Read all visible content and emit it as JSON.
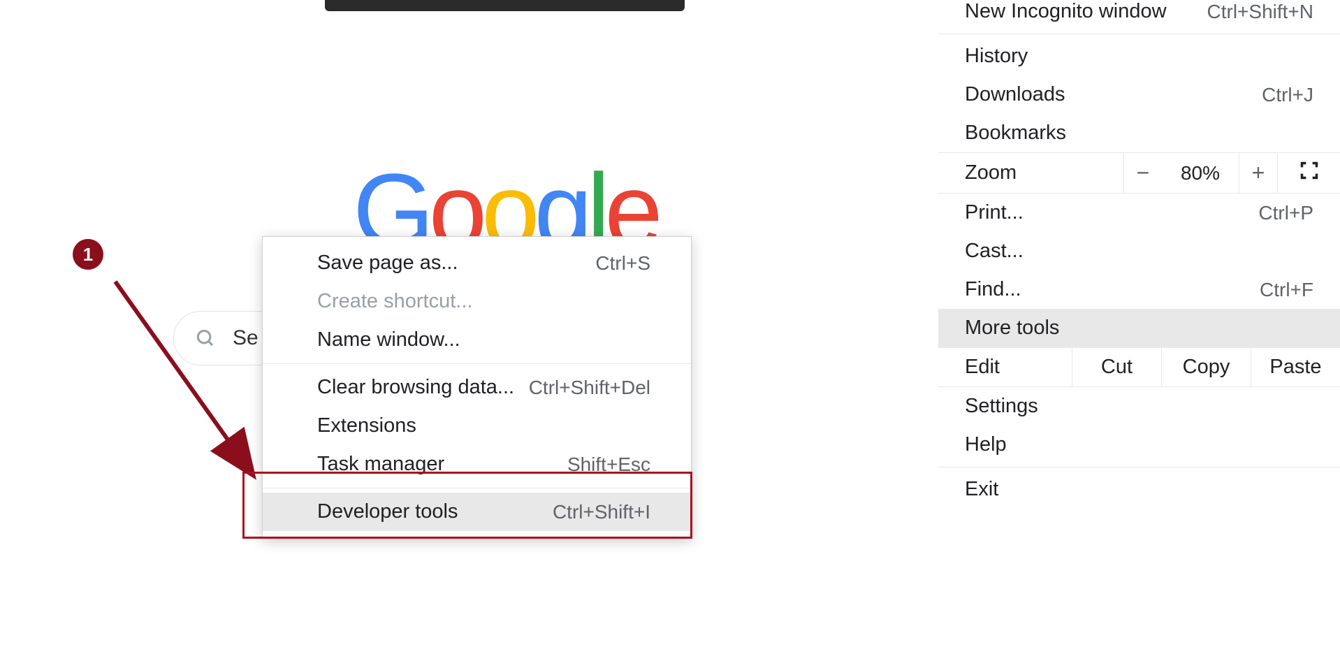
{
  "logo_text": "Google",
  "search": {
    "placeholder": "Se"
  },
  "chrome_menu": {
    "new_incognito": {
      "label": "New Incognito window",
      "shortcut": "Ctrl+Shift+N"
    },
    "history": {
      "label": "History"
    },
    "downloads": {
      "label": "Downloads",
      "shortcut": "Ctrl+J"
    },
    "bookmarks": {
      "label": "Bookmarks"
    },
    "zoom": {
      "label": "Zoom",
      "minus": "−",
      "value": "80%",
      "plus": "+"
    },
    "print": {
      "label": "Print...",
      "shortcut": "Ctrl+P"
    },
    "cast": {
      "label": "Cast..."
    },
    "find": {
      "label": "Find...",
      "shortcut": "Ctrl+F"
    },
    "more_tools": {
      "label": "More tools"
    },
    "edit": {
      "label": "Edit",
      "cut": "Cut",
      "copy": "Copy",
      "paste": "Paste"
    },
    "settings": {
      "label": "Settings"
    },
    "help": {
      "label": "Help"
    },
    "exit": {
      "label": "Exit"
    }
  },
  "submenu": {
    "save_page": {
      "label": "Save page as...",
      "shortcut": "Ctrl+S"
    },
    "create_shortcut": {
      "label": "Create shortcut..."
    },
    "name_window": {
      "label": "Name window..."
    },
    "clear_browsing": {
      "label": "Clear browsing data...",
      "shortcut": "Ctrl+Shift+Del"
    },
    "extensions": {
      "label": "Extensions"
    },
    "task_manager": {
      "label": "Task manager",
      "shortcut": "Shift+Esc"
    },
    "developer_tools": {
      "label": "Developer tools",
      "shortcut": "Ctrl+Shift+I"
    }
  },
  "annotation": {
    "number": "1"
  }
}
